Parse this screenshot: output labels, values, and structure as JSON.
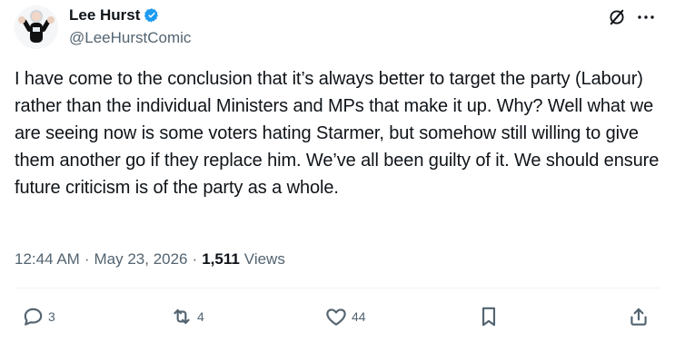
{
  "author": {
    "display_name": "Lee Hurst",
    "handle": "@LeeHurstComic"
  },
  "tweet": {
    "text": "I have come to the conclusion that it’s always better to target the party (Labour) rather than the individual Ministers and MPs that make it up. Why? Well what we are seeing now is some voters hating Starmer, but somehow still willing to give them another go if they replace him. We’ve all been guilty of it. We should ensure future criticism is of the party as a whole.",
    "time": "12:44 AM",
    "date": "May 23, 2026",
    "views_count": "1,511",
    "views_label": "Views",
    "separator": "·"
  },
  "actions": {
    "replies": "3",
    "reposts": "4",
    "likes": "44"
  },
  "icons": {
    "verified": "verified-badge-icon",
    "grok": "grok-icon",
    "more": "more-icon",
    "reply": "reply-icon",
    "repost": "repost-icon",
    "like": "heart-icon",
    "bookmark": "bookmark-icon",
    "share": "share-icon"
  },
  "colors": {
    "verified": "#1d9bf0",
    "text": "#0f1419",
    "secondary": "#536471",
    "divider": "#eff3f4"
  }
}
